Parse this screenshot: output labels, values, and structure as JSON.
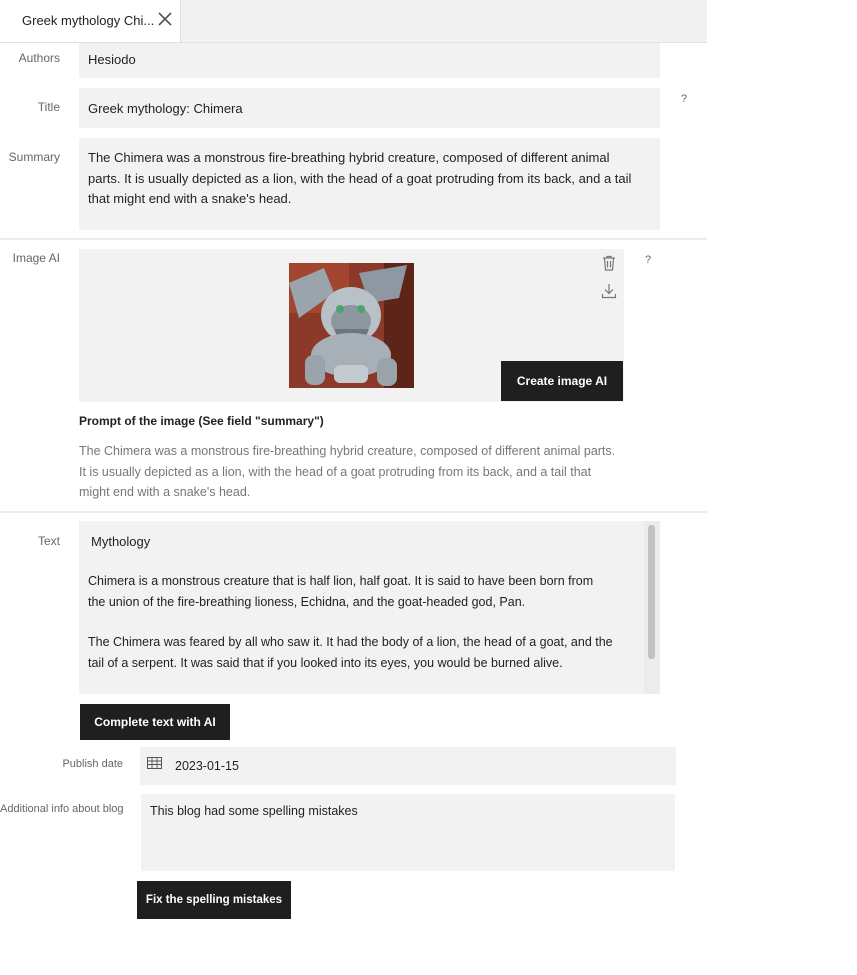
{
  "tab": {
    "title": "Greek mythology Chi...",
    "close_icon": "close-icon"
  },
  "form": {
    "authors": {
      "label": "Authors",
      "value": "Hesiodo"
    },
    "title": {
      "label": "Title",
      "value": "Greek mythology: Chimera",
      "help": "?"
    },
    "summary": {
      "label": "Summary",
      "lines": [
        "The Chimera was a monstrous fire-breathing hybrid creature, composed of different animal",
        "parts. It is usually depicted as a lion, with the head of a goat protruding from its back, and a tail",
        "that might end with a snake's head."
      ]
    },
    "image_ai": {
      "label": "Image AI",
      "help": "?",
      "delete_icon": "trash-icon",
      "download_icon": "download-icon",
      "image_description": "gargoyle-lion-statue",
      "create_button": "Create image AI",
      "prompt_title": "Prompt of the image (See field \"summary\")",
      "prompt_lines": [
        "The Chimera was a monstrous fire-breathing hybrid creature, composed of different animal parts.",
        "It is usually depicted as a lion, with the head of a goat protruding from its back, and a tail that",
        "might end with a snake's head."
      ]
    },
    "text": {
      "label": "Text",
      "heading": "Mythology",
      "paragraph1": [
        "Chimera is a monstrous creature that is half lion, half goat. It is said to have been born from",
        "the union of the fire-breathing lioness, Echidna, and the goat-headed god, Pan."
      ],
      "paragraph2": [
        "The Chimera was feared by all who saw it. It had the body of a lion, the head of a goat, and the",
        "tail of a serpent. It was said that if you looked into its eyes, you would be burned alive."
      ],
      "complete_button": "Complete text with AI"
    },
    "publish_date": {
      "label": "Publish date",
      "value": "2023-01-15",
      "icon": "calendar-icon"
    },
    "additional_info": {
      "label": "Additional info about blog",
      "value": "This blog had some spelling mistakes"
    },
    "fix_button": "Fix the spelling mistakes"
  },
  "colors": {
    "field_bg": "#f2f2f2",
    "button_bg": "#1f1f1f",
    "divider": "#ececec"
  }
}
